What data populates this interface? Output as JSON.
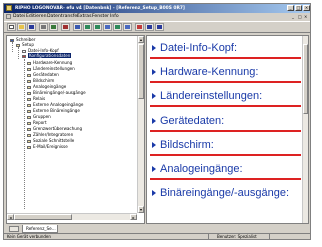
{
  "window": {
    "title": "RIPHO LOGONOVAR- efu v4 [Datenbnk] - [Referenz_Setup_B00S 0R7]",
    "controls": [
      "_",
      "□",
      "×"
    ]
  },
  "menubar": {
    "items": [
      "Datei",
      "Editieren",
      "Datentransfer",
      "Extras",
      "Fenster",
      "Info"
    ],
    "mdi_controls": [
      "_",
      "□",
      "×"
    ]
  },
  "toolbar": {
    "icons": [
      "new-icon",
      "open-icon",
      "save-icon",
      "print-icon",
      "send-icon",
      "connect-icon",
      "setup-icon",
      "read-icon",
      "write-icon",
      "compare-icon",
      "refresh-icon",
      "online-icon",
      "simulate-icon",
      "list-icon",
      "help-icon"
    ]
  },
  "tree": {
    "root": "Schreiber",
    "setup": "Setup",
    "file_info": "Datei-Info-Kopf",
    "config_selected": "Konfigurationsdaten",
    "items": [
      "Hardware-Kennung",
      "Ländereinstellungen",
      "Gerätedaten",
      "Bildschirm",
      "Analogeingänge",
      "Binäreingänge/-ausgänge",
      "Relais",
      "Externe Analogeingänge",
      "Externe Binäreingänge",
      "Gruppen",
      "Report",
      "Grenzwertüberwachung",
      "Zähler/Integratoren",
      "Soziale Schnittstelle",
      "E-Mail/Ereignisse"
    ]
  },
  "content": {
    "sections": [
      "Datei-Info-Kopf:",
      "Hardware-Kennung:",
      "Ländereinstellungen:",
      "Gerätedaten:",
      "Bildschirm:",
      "Analogeingänge:",
      "Binäreingänge/-ausgänge:"
    ],
    "accent_color": "#1a3aa8",
    "rule_color": "#d22222"
  },
  "tabs": {
    "active": "Referenz_Se..."
  },
  "status": {
    "connection": "Kein Gerät verbunden",
    "user": "Benutzer: Spezialist"
  }
}
